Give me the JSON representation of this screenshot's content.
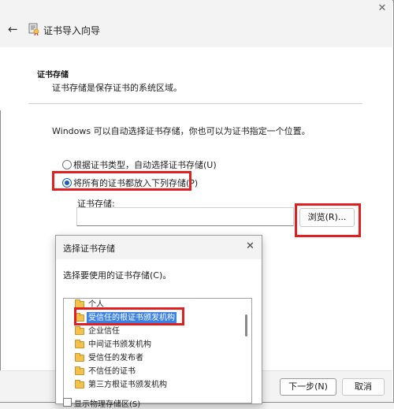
{
  "window": {
    "title": "证书导入向导",
    "close_glyph": "✕",
    "back_glyph": "←"
  },
  "header": {
    "section_title": "证书存储",
    "section_desc": "证书存储是保存证书的系统区域。"
  },
  "main": {
    "intro_text": "Windows 可以自动选择证书存储，你也可以为证书指定一个位置。",
    "options": [
      {
        "label": "根据证书类型，自动选择证书存储(U)",
        "selected": false
      },
      {
        "label": "将所有的证书都放入下列存储(P)",
        "selected": true
      }
    ],
    "store_label": "证书存储:",
    "store_value": "",
    "browse_label": "浏览(R)..."
  },
  "footer": {
    "next_label": "下一步(N)",
    "cancel_label": "取消"
  },
  "dialog": {
    "title": "选择证书存储",
    "close_glyph": "✕",
    "prompt": "选择要使用的证书存储(C)。",
    "stores": [
      {
        "label": "个人",
        "selected": false
      },
      {
        "label": "受信任的根证书颁发机构",
        "selected": true
      },
      {
        "label": "企业信任",
        "selected": false
      },
      {
        "label": "中间证书颁发机构",
        "selected": false
      },
      {
        "label": "受信任的发布者",
        "selected": false
      },
      {
        "label": "不信任的证书",
        "selected": false
      },
      {
        "label": "第三方根证书颁发机构",
        "selected": false
      }
    ],
    "show_physical_label": "显示物理存储区(S)"
  },
  "colors": {
    "highlight": "#e02020",
    "selection": "#3c82e6",
    "folder": "#f2c14e"
  }
}
